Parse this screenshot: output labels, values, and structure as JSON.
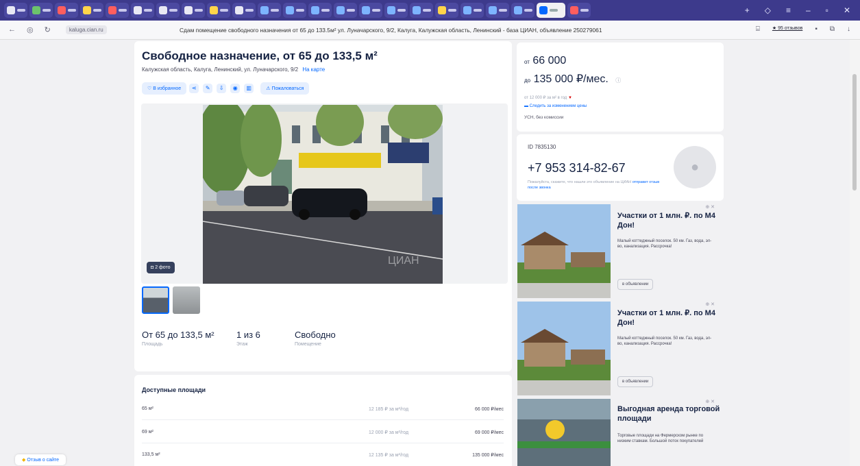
{
  "browser": {
    "address_host": "kaluga.cian.ru",
    "page_title": "Сдам помещение свободного назначения от 65 до 133.5м² ул. Луначарского, 9/2, Калуга, Калужская область, Ленинский - база ЦИАН, объявление 250279061",
    "reviews_label": "★ 95 отзывов"
  },
  "listing": {
    "title": "Свободное назначение, от 65 до 133,5 м²",
    "address": "Калужская область, Калуга, Ленинский, ул. Луначарского, 9/2",
    "map_link": "На карте",
    "favorite_label": "В избранное",
    "complain_label": "Пожаловаться",
    "photo_count": "2 фото",
    "watermark": "ЦИАН",
    "stats": [
      {
        "value": "От 65 до 133,5 м²",
        "label": "Площадь"
      },
      {
        "value": "1 из 6",
        "label": "Этаж"
      },
      {
        "value": "Свободно",
        "label": "Помещение"
      }
    ],
    "available_title": "Доступные площади",
    "available": [
      {
        "area": "65 м²",
        "rate": "12 185 ₽ за м²/год",
        "price": "66 000 ₽/мес"
      },
      {
        "area": "69 м²",
        "rate": "12 000 ₽ за м²/год",
        "price": "69 000 ₽/мес"
      },
      {
        "area": "133,5 м²",
        "rate": "12 135 ₽ за м²/год",
        "price": "135 000 ₽/мес"
      }
    ]
  },
  "price_card": {
    "from_prefix": "от",
    "from_value": "66 000",
    "to_prefix": "до",
    "to_value": "135 000 ₽/мес.",
    "rate": "от 12 000 ₽ за м² в год",
    "history_link": "Следить за изменением цены",
    "terms": "УСН, без комиссии"
  },
  "contact": {
    "id": "ID 7835130",
    "phone": "+7 953 314-82-67",
    "note": "Пожалуйста, скажите, что нашли это объявление на ЦИАН",
    "note_link": "отправит отзыв после звонка"
  },
  "ads": [
    {
      "title": "Участки от 1 млн. ₽. по М4 Дон!",
      "text": "Малый коттеджный поселок. 50 км. Газ, вода, эл-во, канализация. Рассрочка!",
      "button": "в объявлении"
    },
    {
      "title": "Участки от 1 млн. ₽. по М4 Дон!",
      "text": "Малый коттеджный поселок. 50 км. Газ, вода, эл-во, канализация. Рассрочка!",
      "button": "в объявлении"
    },
    {
      "title": "Выгодная аренда торговой площади",
      "text": "Торговые площади на Фермерском рынке по низким ставкам. Большой поток покупателей",
      "button": ""
    }
  ],
  "chat_label": "Отзыв о сайте",
  "colors": {
    "accent": "#0468ff",
    "tabbar": "#3d3a8c",
    "text": "#152242",
    "ad_red": "#d80000"
  }
}
